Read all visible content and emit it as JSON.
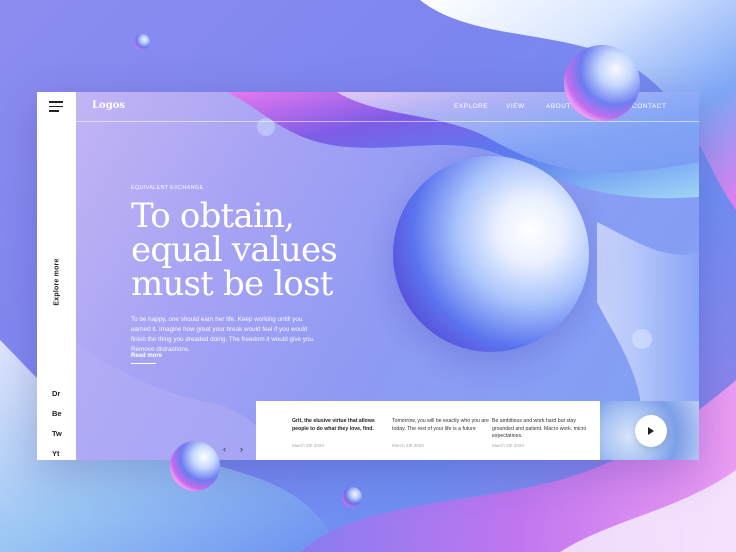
{
  "brand": {
    "logo": "Logos"
  },
  "nav": {
    "explore": "EXPLORE",
    "view": "VIEW",
    "about": "ABOUT",
    "contact": "CONTACT"
  },
  "side": {
    "explore_more": "Explore more",
    "socials": [
      "Dr",
      "Be",
      "Tw",
      "Yt"
    ]
  },
  "hero": {
    "eyebrow": "EQUIVALENT EXCHANGE",
    "headline": [
      "To obtain,",
      "equal values",
      "must be lost"
    ],
    "body": "To be happy, one should earn her life. Keep working untill you earned it. Imagine how great your break would feel if you would finish the thing you dreaded doing. The freedom it would give you. Remove distractions.",
    "cta": "Read more"
  },
  "cards": [
    {
      "text": "Grit, the elusive virtue that allows people to do what they love, find.",
      "date": "March 5th 2020"
    },
    {
      "text": "Tomorrow, you will be exactly who you are today. The rest of your life is a future",
      "date": "March 4th 2020"
    },
    {
      "text": "Be ambitious and work hard but stay grounded and patient. Macro work, micro expectations.",
      "date": "March 3th 2020"
    }
  ],
  "carousel": {
    "prev": "‹",
    "next": "›"
  },
  "icons": {
    "menu": "hamburger-menu-icon",
    "play": "play-icon",
    "prev": "chevron-left-icon",
    "next": "chevron-right-icon"
  },
  "colors": {
    "accent_blue": "#5b74ee",
    "accent_pink": "#e87ff2",
    "accent_purple": "#8d8cf0"
  }
}
